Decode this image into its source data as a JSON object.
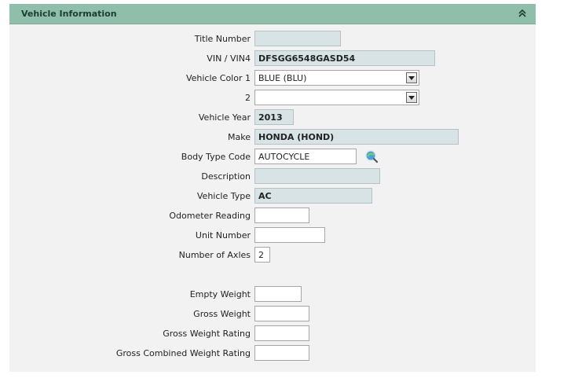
{
  "panel": {
    "title": "Vehicle Information",
    "collapse_icon": "double-chevron-up-icon"
  },
  "fields": {
    "title_number": {
      "label": "Title Number",
      "value": ""
    },
    "vin": {
      "label": "VIN / VIN4",
      "value": "DFSGG6548GASD54"
    },
    "color1": {
      "label": "Vehicle Color 1",
      "value": "BLUE (BLU)"
    },
    "color2": {
      "label": "2",
      "value": ""
    },
    "year": {
      "label": "Vehicle Year",
      "value": "2013"
    },
    "make": {
      "label": "Make",
      "value": "HONDA (HOND)"
    },
    "body_type": {
      "label": "Body Type Code",
      "value": "AUTOCYCLE",
      "lookup_icon": "lookup-search-icon"
    },
    "description": {
      "label": "Description",
      "value": ""
    },
    "vehicle_type": {
      "label": "Vehicle Type",
      "value": "AC"
    },
    "odometer": {
      "label": "Odometer Reading",
      "value": ""
    },
    "unit_number": {
      "label": "Unit Number",
      "value": ""
    },
    "axles": {
      "label": "Number of Axles",
      "value": "2"
    },
    "empty_weight": {
      "label": "Empty Weight",
      "value": ""
    },
    "gross_weight": {
      "label": "Gross Weight",
      "value": ""
    },
    "gross_weight_rating": {
      "label": "Gross Weight Rating",
      "value": ""
    },
    "gross_combined_weight_rating": {
      "label": "Gross Combined Weight Rating",
      "value": ""
    }
  },
  "colors": {
    "header_bg": "#8fbfaa",
    "panel_bg": "#f2f2f2",
    "readonly_bg": "#d7e3e4"
  }
}
